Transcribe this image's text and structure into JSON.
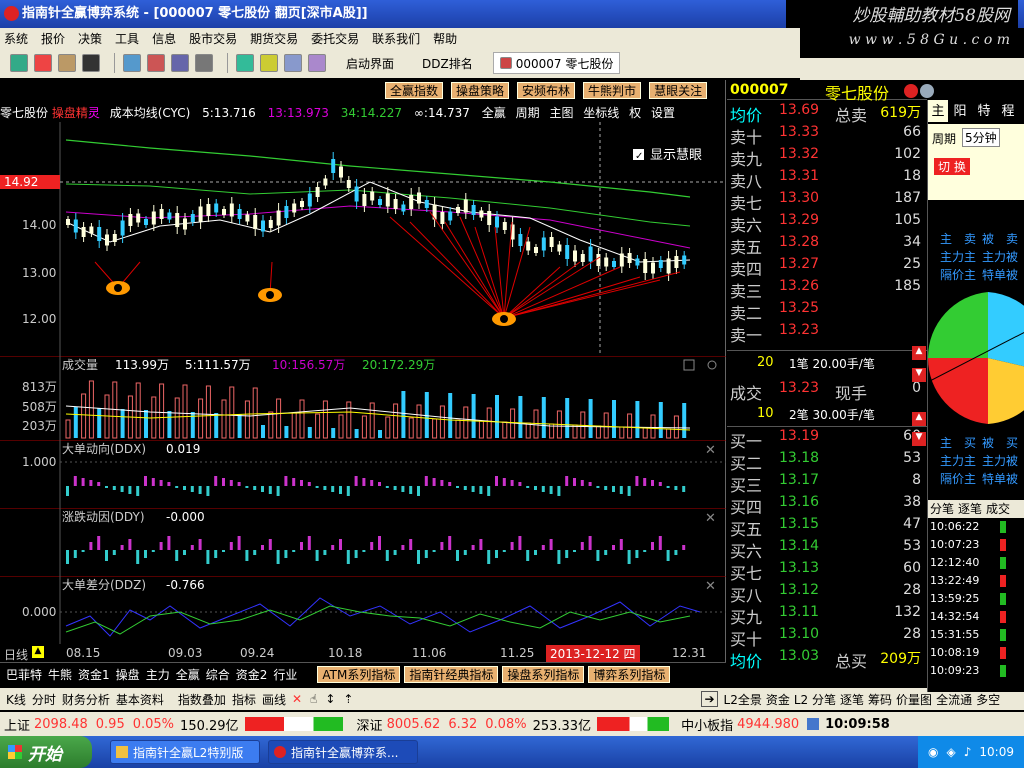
{
  "window": {
    "title": "指南针全赢博弈系统 - [000007 零七股份 翻页[深市A股]]"
  },
  "watermark": {
    "line1": "炒股輔助教材58股网",
    "line2": "w w w . 5 8 G u . c o m"
  },
  "menu": [
    "系统",
    "报价",
    "决策",
    "工具",
    "信息",
    "股市交易",
    "期货交易",
    "委托交易",
    "联系我们",
    "帮助"
  ],
  "toolbar": {
    "home": "启动界面",
    "ddz": "DDZ排名",
    "stock": "000007 零七股份"
  },
  "chart_buttons": [
    "全赢指数",
    "操盘策略",
    "安频布林",
    "牛熊判市",
    "慧眼关注"
  ],
  "main_header": {
    "name": "零七股份",
    "tag1": "操盘精",
    "tag2": "灵",
    "indicator": "成本均线(CYC)",
    "m5": "5:13.716",
    "m13": "13:13.973",
    "m34": "34:14.227",
    "minf": "∞:14.737",
    "r1": "全赢",
    "r2": "周期",
    "r3": "主图",
    "r4": "坐标线",
    "r5": "权",
    "r6": "设置"
  },
  "main_chart": {
    "price_label": "14.92",
    "checkbox": "显示慧眼",
    "yticks": [
      "14.00",
      "13.00",
      "12.00"
    ]
  },
  "volume_panel": {
    "title": "成交量",
    "v": "113.99万",
    "m5": "5:111.57万",
    "m10": "10:156.57万",
    "m20": "20:172.29万",
    "yticks": [
      "813万",
      "508万",
      "203万"
    ]
  },
  "ddx_panel": {
    "title": "大单动向(DDX)",
    "value": "0.019",
    "ytick": "1.000"
  },
  "ddy_panel": {
    "title": "涨跌动因(DDY)",
    "value": "-0.000"
  },
  "ddz_panel": {
    "title": "大单差分(DDZ)",
    "value": "-0.766",
    "ytick": "0.000"
  },
  "dates": [
    "08.15",
    "09.03",
    "09.24",
    "10.18",
    "11.06",
    "11.25",
    "12.31"
  ],
  "cursor_date": "2013-12-12 四",
  "period_tab": "日线",
  "right_panel": {
    "code": "000007",
    "name": "零七股份",
    "avg_label": "均价",
    "avg": "13.69",
    "sell_total_label": "总卖",
    "sell_total": "619万",
    "sells": [
      {
        "l": "卖十",
        "p": "13.33",
        "v": "66"
      },
      {
        "l": "卖九",
        "p": "13.32",
        "v": "102"
      },
      {
        "l": "卖八",
        "p": "13.31",
        "v": "18"
      },
      {
        "l": "卖七",
        "p": "13.30",
        "v": "187"
      },
      {
        "l": "卖六",
        "p": "13.29",
        "v": "105"
      },
      {
        "l": "卖五",
        "p": "13.28",
        "v": "34"
      },
      {
        "l": "卖四",
        "p": "13.27",
        "v": "25"
      },
      {
        "l": "卖三",
        "p": "13.26",
        "v": "185"
      },
      {
        "l": "卖二",
        "p": "13.25",
        "v": ""
      },
      {
        "l": "卖一",
        "p": "13.23",
        "v": ""
      }
    ],
    "t1_count": "20",
    "t1_text": "1笔 20.00手/笔",
    "deal_label": "成交",
    "deal": "13.23",
    "now_label": "现手",
    "now": "0",
    "t2_count": "10",
    "t2_text": "2笔 30.00手/笔",
    "buys": [
      {
        "l": "买一",
        "p": "13.19",
        "v": "60"
      },
      {
        "l": "买二",
        "p": "13.18",
        "v": "53"
      },
      {
        "l": "买三",
        "p": "13.17",
        "v": "8"
      },
      {
        "l": "买四",
        "p": "13.16",
        "v": "38"
      },
      {
        "l": "买五",
        "p": "13.15",
        "v": "47"
      },
      {
        "l": "买六",
        "p": "13.14",
        "v": "53"
      },
      {
        "l": "买七",
        "p": "13.13",
        "v": "60"
      },
      {
        "l": "买八",
        "p": "13.12",
        "v": "28"
      },
      {
        "l": "买九",
        "p": "13.11",
        "v": "132"
      },
      {
        "l": "买十",
        "p": "13.10",
        "v": "28"
      }
    ],
    "avg2_label": "均价",
    "avg2": "13.03",
    "buy_total_label": "总买",
    "buy_total": "209万"
  },
  "far_right": {
    "tabs": [
      "主",
      "阳",
      "特",
      "程"
    ],
    "period": "周期",
    "period_val": "5分钟",
    "switch": "切 换",
    "grid1": [
      [
        "主",
        "卖",
        "被",
        "卖"
      ],
      [
        "主力主",
        "主力被"
      ],
      [
        "隔价主",
        "特单被"
      ]
    ],
    "grid2": [
      [
        "主",
        "买",
        "被",
        "买"
      ],
      [
        "主力主",
        "主力被"
      ],
      [
        "隔价主",
        "特单被"
      ]
    ],
    "tick_tabs": [
      "分笔",
      "逐笔",
      "成交"
    ],
    "ticks": [
      "10:06:22",
      "10:07:23",
      "12:12:40",
      "13:22:49",
      "13:59:25",
      "14:32:54",
      "15:31:55",
      "10:08:19",
      "10:09:23"
    ]
  },
  "bottom_tabs": [
    "巴菲特",
    "牛熊",
    "资金1",
    "操盘",
    "主力",
    "全赢",
    "综合",
    "资金2",
    "行业"
  ],
  "bottom_series": [
    "ATM系列指标",
    "指南针经典指标",
    "操盘系列指标",
    "博弈系列指标"
  ],
  "bottom_row2": [
    "K线",
    "分时",
    "财务分析",
    "基本资料",
    "指数叠加",
    "指标",
    "画线"
  ],
  "bottom_row2_right": [
    "L2全景",
    "资金",
    "L2 分笔",
    "逐笔",
    "筹码",
    "价量图",
    "全流通",
    "多空"
  ],
  "status": {
    "sh_label": "上证",
    "sh": "2098.48",
    "sh_chg": "0.95",
    "sh_pct": "0.05%",
    "sh_amt": "150.29亿",
    "sz_label": "深证",
    "sz": "8005.62",
    "sz_chg": "6.32",
    "sz_pct": "0.08%",
    "sz_amt": "253.33亿",
    "zx_label": "中小板指",
    "zx": "4944.980",
    "time": "10:09:58"
  },
  "taskbar": {
    "start": "开始",
    "task1": "指南针全赢L2特别版",
    "task2": "指南针全赢博弈系...",
    "clock": "10:09"
  }
}
